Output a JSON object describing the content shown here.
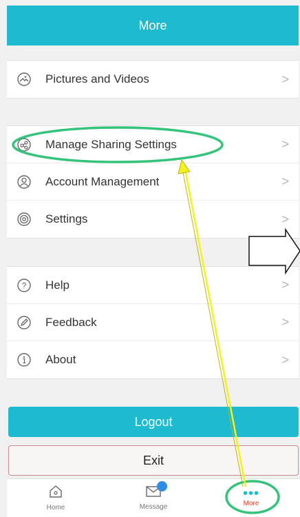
{
  "header": {
    "title": "More"
  },
  "menu": {
    "group1": [
      {
        "label": "Pictures and Videos",
        "icon": "pictures-icon"
      }
    ],
    "group2": [
      {
        "label": "Manage Sharing Settings",
        "icon": "share-icon"
      },
      {
        "label": "Account Management",
        "icon": "account-icon"
      },
      {
        "label": "Settings",
        "icon": "settings-icon"
      }
    ],
    "group3": [
      {
        "label": "Help",
        "icon": "help-icon"
      },
      {
        "label": "Feedback",
        "icon": "feedback-icon"
      },
      {
        "label": "About",
        "icon": "about-icon"
      }
    ],
    "chevron": ">"
  },
  "buttons": {
    "logout": "Logout",
    "exit": "Exit"
  },
  "tabbar": {
    "home": "Home",
    "message": "Message",
    "more": "More",
    "more_dots": "•••"
  },
  "colors": {
    "accent": "#1ebad0",
    "active_tab": "#e0422c",
    "annotation_green": "#34c37a",
    "annotation_yellow": "#f3f21f"
  }
}
